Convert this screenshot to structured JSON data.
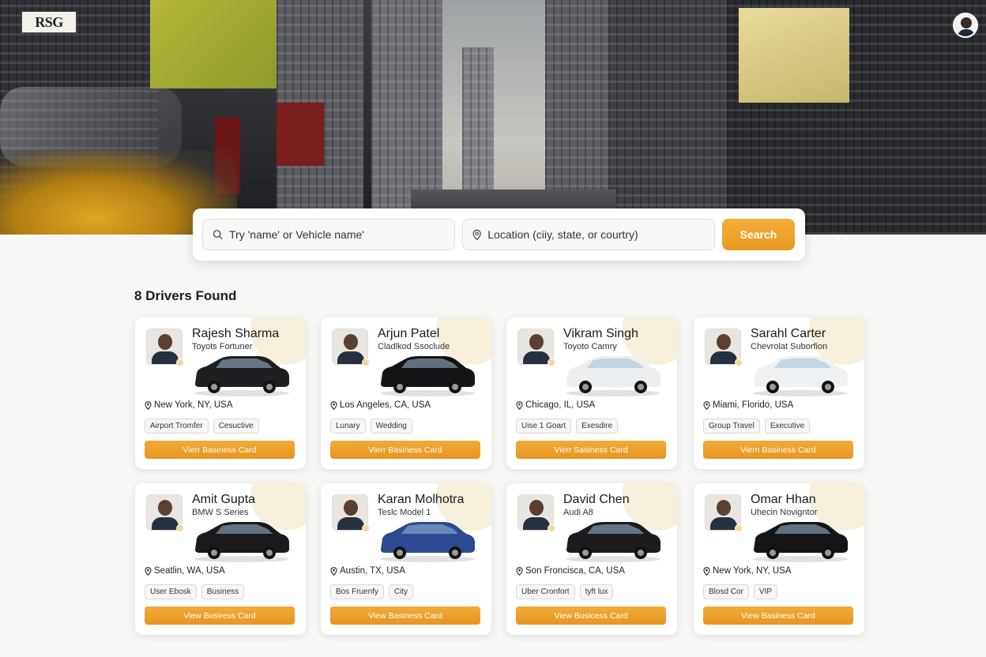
{
  "header": {
    "logo_text": "RSG"
  },
  "search": {
    "name_placeholder": "Try 'name' or Vehicle name'",
    "location_placeholder": "Location (ciiy, state, or courtry)",
    "button_label": "Search"
  },
  "results": {
    "count_label": "8 Drivers Found"
  },
  "colors": {
    "accent": "#e89a22",
    "page_bg": "#f7f7f5"
  },
  "drivers": [
    {
      "name": "Rajesh Sharma",
      "vehicle": "Toyots Fortuner",
      "location": "New York, NY, USA",
      "tags": [
        "Airport Tromfer",
        "Cesuctive"
      ],
      "cta": "Vierr Basiness Card",
      "car_color": "#1f1f22"
    },
    {
      "name": "Arjun Patel",
      "vehicle": "Cladlkod Ssoclude",
      "location": "Los Angeles, CA, USA",
      "tags": [
        "Lunary",
        "Wedding"
      ],
      "cta": "Vierr Basiness Card",
      "car_color": "#141416"
    },
    {
      "name": "Vikram Singh",
      "vehicle": "Toyoto Camry",
      "location": "Chicago, IL, USA",
      "tags": [
        "Uise 1 Goart",
        "Exesdire"
      ],
      "cta": "Vierr Sasiness Card",
      "car_color": "#eceef0"
    },
    {
      "name": "Sarahl Carter",
      "vehicle": "Chevrolat Suborfion",
      "location": "Miami, Florido, USA",
      "tags": [
        "Group Travel",
        "Executive"
      ],
      "cta": "Viern Basiness Card",
      "car_color": "#f0f1f2"
    },
    {
      "name": "Amit Gupta",
      "vehicle": "BMW S Series",
      "location": "Seatlin, WA, USA",
      "tags": [
        "User Ebosk",
        "Business"
      ],
      "cta": "View Busiress Card",
      "car_color": "#1a1a1c"
    },
    {
      "name": "Karan Molhotra",
      "vehicle": "Teslc Model 1",
      "location": "Austin, TX, USA",
      "tags": [
        "Bos Fruenfy",
        "City"
      ],
      "cta": "View Basiness Card",
      "car_color": "#2a4a92"
    },
    {
      "name": "David Chen",
      "vehicle": "Audi A8",
      "location": "Son Froncisca, CA, USA",
      "tags": [
        "Uber Cronfort",
        "tyft lux"
      ],
      "cta": "View Busicess Card",
      "car_color": "#1c1c1e"
    },
    {
      "name": "Omar Hhan",
      "vehicle": "Uhecin Novigntor",
      "location": "New York, NY, USA",
      "tags": [
        "Blosd Cor",
        "VIP"
      ],
      "cta": "View Basiness Card",
      "car_color": "#151517"
    }
  ]
}
